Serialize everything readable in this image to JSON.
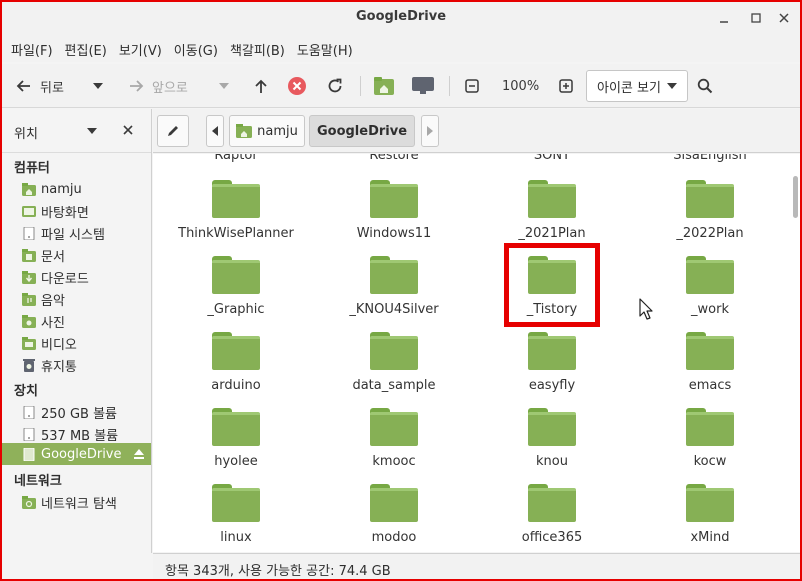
{
  "window": {
    "title": "GoogleDrive"
  },
  "menu": [
    "파일(F)",
    "편집(E)",
    "보기(V)",
    "이동(G)",
    "책갈피(B)",
    "도움말(H)"
  ],
  "toolbar": {
    "back": "뒤로",
    "forward": "앞으로",
    "zoom": "100%",
    "view_mode": "아이콘 보기"
  },
  "sidebar": {
    "header": "위치",
    "sections": [
      {
        "title": "컴퓨터",
        "items": [
          {
            "label": "namju",
            "icon": "home-folder-icon"
          },
          {
            "label": "바탕화면",
            "icon": "desktop-icon"
          },
          {
            "label": "파일 시스템",
            "icon": "drive-icon"
          },
          {
            "label": "문서",
            "icon": "documents-folder-icon"
          },
          {
            "label": "다운로드",
            "icon": "downloads-folder-icon"
          },
          {
            "label": "음악",
            "icon": "music-folder-icon"
          },
          {
            "label": "사진",
            "icon": "pictures-folder-icon"
          },
          {
            "label": "비디오",
            "icon": "videos-folder-icon"
          },
          {
            "label": "휴지통",
            "icon": "trash-icon"
          }
        ]
      },
      {
        "title": "장치",
        "items": [
          {
            "label": "250 GB 볼륨",
            "icon": "drive-icon"
          },
          {
            "label": "537 MB 볼륨",
            "icon": "drive-icon"
          },
          {
            "label": "GoogleDrive",
            "icon": "drive-icon",
            "active": true
          }
        ]
      },
      {
        "title": "네트워크",
        "items": [
          {
            "label": "네트워크 탐색",
            "icon": "network-icon"
          }
        ]
      }
    ]
  },
  "pathbar": {
    "crumbs": [
      "namju",
      "GoogleDrive"
    ],
    "current": "GoogleDrive"
  },
  "files": {
    "partial_row": [
      "Raptor",
      "Restore",
      "SONY",
      "SisaEnglish"
    ],
    "rows": [
      [
        "ThinkWisePlanner",
        "Windows11",
        "_2021Plan",
        "_2022Plan"
      ],
      [
        "_Graphic",
        "_KNOU4Silver",
        "_Tistory",
        "_work"
      ],
      [
        "arduino",
        "data_sample",
        "easyfly",
        "emacs"
      ],
      [
        "hyolee",
        "kmooc",
        "knou",
        "kocw"
      ],
      [
        "linux",
        "modoo",
        "office365",
        "xMind"
      ]
    ]
  },
  "status": {
    "text": "항목 343개, 사용 가능한 공간: 74.4 GB"
  },
  "colors": {
    "folder": "#86b055",
    "accent": "#8fb15a",
    "highlight": "#e60000"
  }
}
